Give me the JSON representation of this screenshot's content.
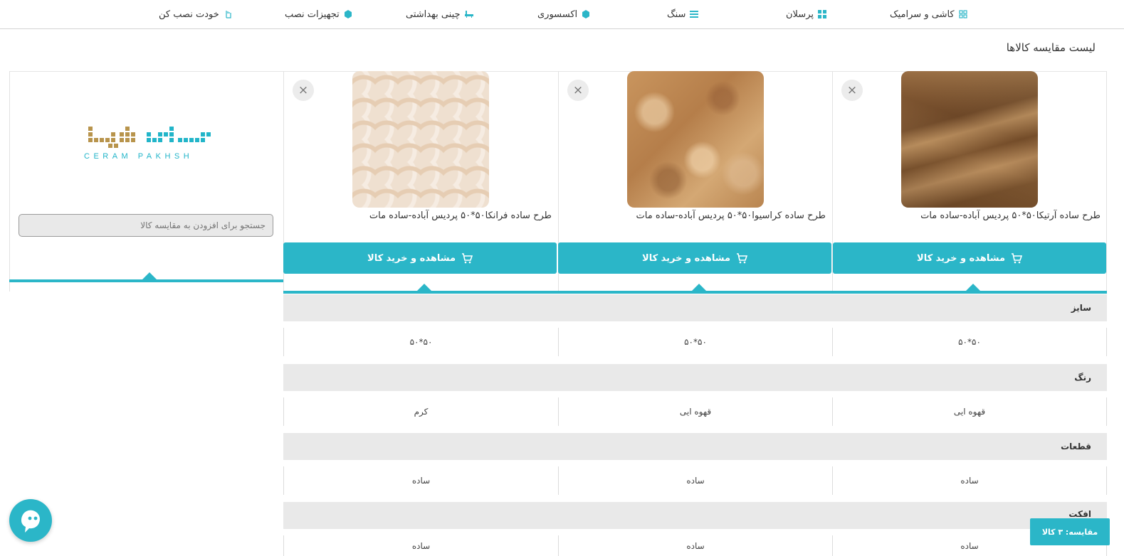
{
  "nav": {
    "items": [
      {
        "label": "کاشی و سرامیک",
        "icon": "grid-tiles-icon"
      },
      {
        "label": "پرسلان",
        "icon": "four-squares-icon"
      },
      {
        "label": "سنگ",
        "icon": "stack-icon"
      },
      {
        "label": "اکسسوری",
        "icon": "gem-icon"
      },
      {
        "label": "چینی بهداشتی",
        "icon": "bathtub-icon"
      },
      {
        "label": "تجهیزات نصب",
        "icon": "gem-icon"
      },
      {
        "label": "خودت نصب کن",
        "icon": "hand-icon"
      }
    ]
  },
  "page": {
    "title": "لیست مقایسه کالاها"
  },
  "logo": {
    "text": "CERAM PAKHSH"
  },
  "search": {
    "placeholder": "جستجو برای افزودن به مقایسه کالا"
  },
  "products": [
    {
      "name": "طرح ساده آرتیکا۵۰*۵۰ پردیس آباده-ساده مات",
      "buy_label": "مشاهده و خرید کالا",
      "close": "×"
    },
    {
      "name": "طرح ساده کراسیوا۵۰*۵۰ پردیس آباده-ساده مات",
      "buy_label": "مشاهده و خرید کالا",
      "close": "×"
    },
    {
      "name": "طرح ساده فرانکا۵۰*۵۰ پردیس آباده-ساده مات",
      "buy_label": "مشاهده و خرید کالا",
      "close": "×"
    }
  ],
  "attributes": [
    {
      "label": "سایز",
      "values": [
        "۵۰*۵۰",
        "۵۰*۵۰",
        "۵۰*۵۰"
      ]
    },
    {
      "label": "رنگ",
      "values": [
        "قهوه ایی",
        "قهوه ایی",
        "کرم"
      ]
    },
    {
      "label": "قطعات",
      "values": [
        "ساده",
        "ساده",
        "ساده"
      ]
    },
    {
      "label": "افکت",
      "values": [
        "ساده",
        "ساده",
        "ساده"
      ]
    }
  ],
  "compare_badge": {
    "label": "مقایسه: ۳ کالا"
  },
  "colors": {
    "accent": "#2bb6c8",
    "logo_gold": "#b8944c",
    "logo_teal": "#22b5c9"
  }
}
